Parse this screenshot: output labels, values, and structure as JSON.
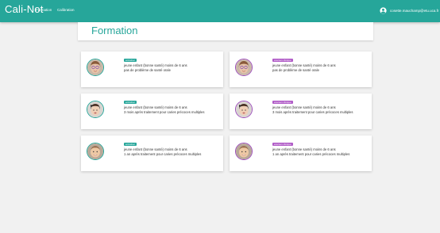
{
  "nav": {
    "brand": "Cali-Not",
    "links": [
      "Formation",
      "Calibration"
    ],
    "user_email": "cosette.mauchamp@etu.uca.fr",
    "accent_color": "#26a69a"
  },
  "page": {
    "title": "Formation"
  },
  "cards": [
    {
      "badge": "entraîner",
      "badge_color": "#26a69a",
      "line1": "jeune enfant (bonne santé) moins de 6 ans",
      "line2": "pas de problème de santé orale",
      "avatar": "girl-glasses-photo"
    },
    {
      "badge": "examen clinique",
      "badge_color": "#b05ac7",
      "line1": "jeune enfant (bonne santé) moins de 6 ans",
      "line2": "pas de problème de santé orale",
      "avatar": "girl-glasses-photo"
    },
    {
      "badge": "entraîner",
      "badge_color": "#26a69a",
      "line1": "jeune enfant (bonne santé) moins de 6 ans",
      "line2": "3 mois après traitement pour caries précoces multiples",
      "avatar": "child-bow-photo"
    },
    {
      "badge": "examen clinique",
      "badge_color": "#b05ac7",
      "line1": "jeune enfant (bonne santé) moins de 6 ans",
      "line2": "3 mois après traitement pour caries précoces multiples",
      "avatar": "child-bow-photo"
    },
    {
      "badge": "entraîner",
      "badge_color": "#26a69a",
      "line1": "jeune enfant (bonne santé) moins de 6 ans",
      "line2": "1 an après traitement pour caries précoces multiples",
      "avatar": "toddler-photo"
    },
    {
      "badge": "examen clinique",
      "badge_color": "#b05ac7",
      "line1": "jeune enfant (bonne santé) moins de 6 ans",
      "line2": "1 an après traitement pour caries précoces multiples",
      "avatar": "toddler-photo"
    }
  ]
}
